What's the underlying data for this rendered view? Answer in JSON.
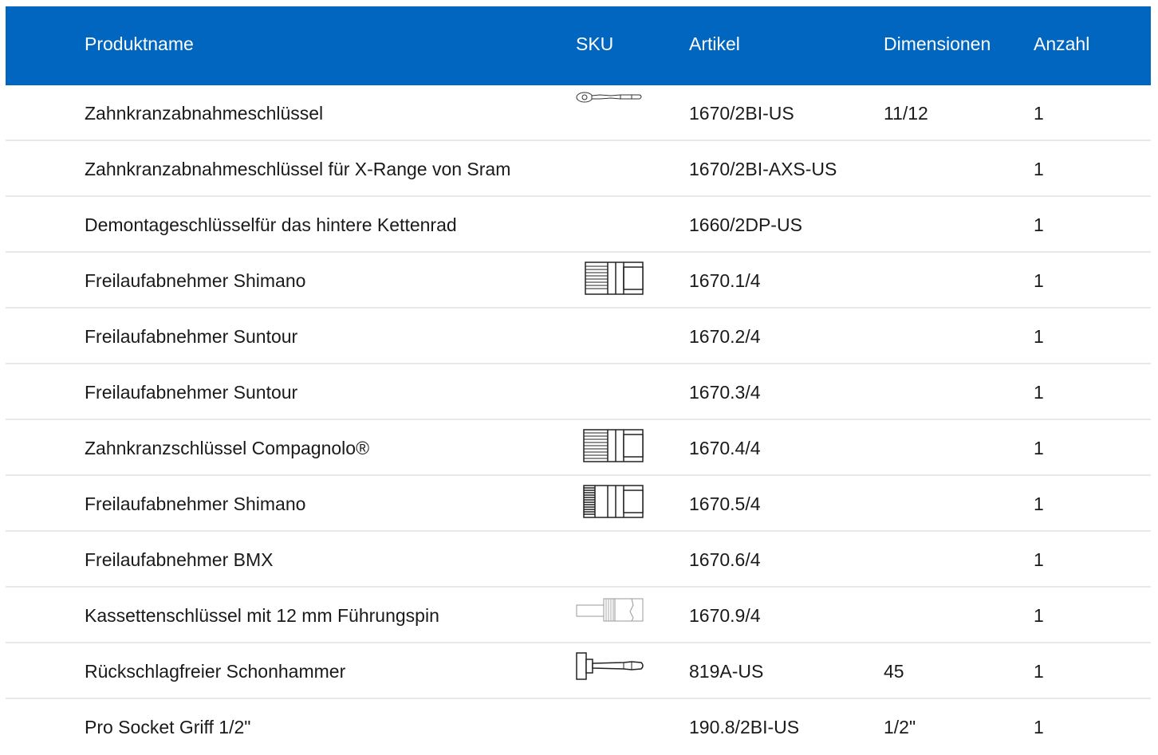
{
  "table": {
    "headers": {
      "name": "Produktname",
      "sku": "SKU",
      "article": "Artikel",
      "dimensions": "Dimensionen",
      "quantity": "Anzahl"
    },
    "rows": [
      {
        "name": "Zahnkranzabnahmeschlüssel",
        "sku_icon": "ratchet-wrench-icon",
        "article": "1670/2BI-US",
        "dimensions": "11/12",
        "quantity": "1"
      },
      {
        "name": "Zahnkranzabnahmeschlüssel für X-Range von Sram",
        "sku_icon": "",
        "article": "1670/2BI-AXS-US",
        "dimensions": "",
        "quantity": "1"
      },
      {
        "name": "Demontageschlüsselfür das hintere Kettenrad",
        "sku_icon": "",
        "article": "1660/2DP-US",
        "dimensions": "",
        "quantity": "1"
      },
      {
        "name": "Freilaufabnehmer Shimano",
        "sku_icon": "freewheel-remover-icon",
        "article": "1670.1/4",
        "dimensions": "",
        "quantity": "1"
      },
      {
        "name": "Freilaufabnehmer Suntour",
        "sku_icon": "",
        "article": "1670.2/4",
        "dimensions": "",
        "quantity": "1"
      },
      {
        "name": "Freilaufabnehmer Suntour",
        "sku_icon": "",
        "article": "1670.3/4",
        "dimensions": "",
        "quantity": "1"
      },
      {
        "name": "Zahnkranzschlüssel Compagnolo®",
        "sku_icon": "freewheel-remover-icon",
        "article": "1670.4/4",
        "dimensions": "",
        "quantity": "1"
      },
      {
        "name": "Freilaufabnehmer Shimano",
        "sku_icon": "freewheel-remover-dense-icon",
        "article": "1670.5/4",
        "dimensions": "",
        "quantity": "1"
      },
      {
        "name": "Freilaufabnehmer BMX",
        "sku_icon": "",
        "article": "1670.6/4",
        "dimensions": "",
        "quantity": "1"
      },
      {
        "name": "Kassettenschlüssel mit 12 mm Führungspin",
        "sku_icon": "cassette-tool-icon",
        "article": "1670.9/4",
        "dimensions": "",
        "quantity": "1"
      },
      {
        "name": "Rückschlagfreier Schonhammer",
        "sku_icon": "dead-blow-hammer-icon",
        "article": "819A-US",
        "dimensions": "45",
        "quantity": "1"
      },
      {
        "name": "Pro Socket Griff 1/2\"",
        "sku_icon": "",
        "article": "190.8/2BI-US",
        "dimensions": "1/2\"",
        "quantity": "1"
      }
    ]
  },
  "colors": {
    "header_bg": "#0066c0",
    "header_text": "#ffffff",
    "row_divider": "#e9e9e9",
    "body_text": "#1a1a1a"
  }
}
